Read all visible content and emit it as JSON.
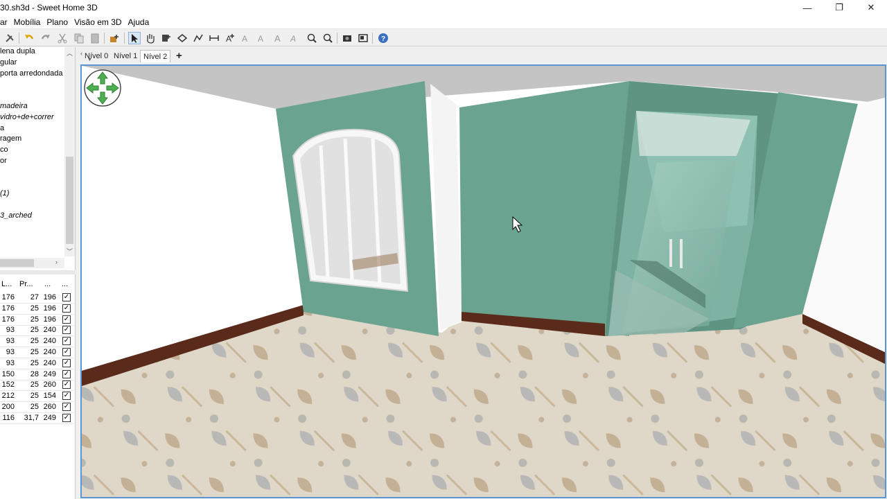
{
  "window": {
    "title": "30.sh3d - Sweet Home 3D",
    "minimize": "—",
    "maximize": "❐",
    "close": "✕"
  },
  "menu": [
    "ar",
    "Mobília",
    "Plano",
    "Visão em 3D",
    "Ajuda"
  ],
  "toolbar_icons": [
    "preferences-icon",
    "undo-icon",
    "redo-icon",
    "cut-icon",
    "copy-icon",
    "paste-icon",
    "add-furniture-icon",
    "select-icon",
    "pan-icon",
    "create-walls-icon",
    "create-rooms-icon",
    "create-polylines-icon",
    "create-dimensions-icon",
    "add-text-icon",
    "modify-text-icon",
    "increase-text-icon",
    "decrease-text-icon",
    "bold-italic-icon",
    "zoom-in-icon",
    "zoom-out-icon",
    "create-photo-icon",
    "create-video-icon",
    "help-icon"
  ],
  "catalog": {
    "items": [
      {
        "label": "lena dupla",
        "italic": false
      },
      {
        "label": "gular",
        "italic": false
      },
      {
        "label": "porta arredondada",
        "italic": false
      },
      {
        "label": "",
        "italic": false
      },
      {
        "label": "",
        "italic": false
      },
      {
        "label": "madeira",
        "italic": true
      },
      {
        "label": "vidro+de+correr",
        "italic": true
      },
      {
        "label": "a",
        "italic": false
      },
      {
        "label": "ragem",
        "italic": false
      },
      {
        "label": "co",
        "italic": false
      },
      {
        "label": "or",
        "italic": false
      },
      {
        "label": "",
        "italic": false
      },
      {
        "label": "",
        "italic": false
      },
      {
        "label": " (1)",
        "italic": true
      },
      {
        "label": "",
        "italic": false
      },
      {
        "label": "3_arched",
        "italic": true
      }
    ]
  },
  "furniture_table": {
    "headers": [
      "L...",
      "Pr...",
      "...",
      "..."
    ],
    "rows": [
      {
        "w": "176",
        "d": "27",
        "h": "196",
        "visible": true
      },
      {
        "w": "176",
        "d": "25",
        "h": "196",
        "visible": true
      },
      {
        "w": "176",
        "d": "25",
        "h": "196",
        "visible": true
      },
      {
        "w": "93",
        "d": "25",
        "h": "240",
        "visible": true
      },
      {
        "w": "93",
        "d": "25",
        "h": "240",
        "visible": true
      },
      {
        "w": "93",
        "d": "25",
        "h": "240",
        "visible": true
      },
      {
        "w": "93",
        "d": "25",
        "h": "240",
        "visible": true
      },
      {
        "w": "150",
        "d": "28",
        "h": "249",
        "visible": true
      },
      {
        "w": "152",
        "d": "25",
        "h": "260",
        "visible": true
      },
      {
        "w": "212",
        "d": "25",
        "h": "154",
        "visible": true
      },
      {
        "w": "200",
        "d": "25",
        "h": "260",
        "visible": true
      },
      {
        "w": "116",
        "d": "31,7",
        "h": "249",
        "visible": true
      }
    ]
  },
  "level_tabs": {
    "tabs": [
      "Nível 0",
      "Nível 1",
      "Nível 2"
    ],
    "selected": "Nível 2",
    "add_label": "+"
  },
  "colors": {
    "wall": "#6aa390",
    "wall_dark": "#5f9483",
    "floor": "#d9d0c0",
    "baseboard": "#5a2a1a",
    "ceiling": "#bdbdbd",
    "view_border": "#5b95d4",
    "nav_arrows": "#4caf50"
  }
}
